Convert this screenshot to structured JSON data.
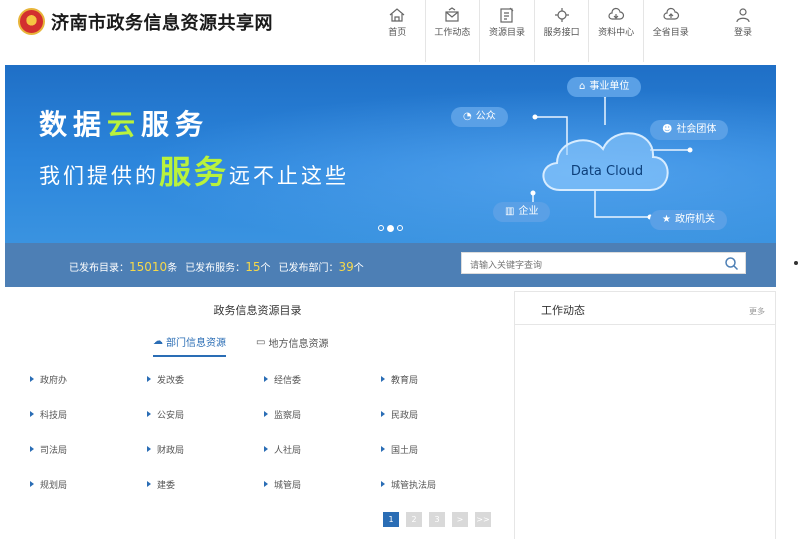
{
  "header": {
    "site_title": "济南市政务信息资源共享网",
    "nav": [
      {
        "label": "首页",
        "icon": "home-icon"
      },
      {
        "label": "工作动态",
        "icon": "news-icon"
      },
      {
        "label": "资源目录",
        "icon": "catalog-icon"
      },
      {
        "label": "服务接口",
        "icon": "interface-icon"
      },
      {
        "label": "资料中心",
        "icon": "cloud-download-icon"
      },
      {
        "label": "全省目录",
        "icon": "cloud-upload-icon"
      }
    ],
    "login_label": "登录"
  },
  "banner": {
    "slogan_line1_a": "数据",
    "slogan_line1_b": "云",
    "slogan_line1_c": "服务",
    "slogan_line2_a": "我们提供的",
    "slogan_line2_b": "服务",
    "slogan_line2_c": "远不止这些",
    "cloud_label": "Data Cloud",
    "pills": {
      "public": "公众",
      "institution": "事业单位",
      "social": "社会团体",
      "enterprise": "企业",
      "government": "政府机关"
    }
  },
  "stats": {
    "catalog_label": "已发布目录：",
    "catalog_value": "15010",
    "catalog_unit": "条",
    "service_label": "已发布服务：",
    "service_value": "15",
    "service_unit": "个",
    "dept_label": "已发布部门：",
    "dept_value": "39",
    "dept_unit": "个"
  },
  "search": {
    "placeholder": "请输入关键字查询"
  },
  "catalog": {
    "title": "政务信息资源目录",
    "tabs": [
      "部门信息资源",
      "地方信息资源"
    ],
    "items": [
      "政府办",
      "发改委",
      "经信委",
      "教育局",
      "科技局",
      "公安局",
      "监察局",
      "民政局",
      "司法局",
      "财政局",
      "人社局",
      "国土局",
      "规划局",
      "建委",
      "城管局",
      "城管执法局"
    ],
    "pages": [
      "1",
      "2",
      "3",
      ">",
      ">>"
    ]
  },
  "news": {
    "title": "工作动态",
    "more": "更多"
  }
}
